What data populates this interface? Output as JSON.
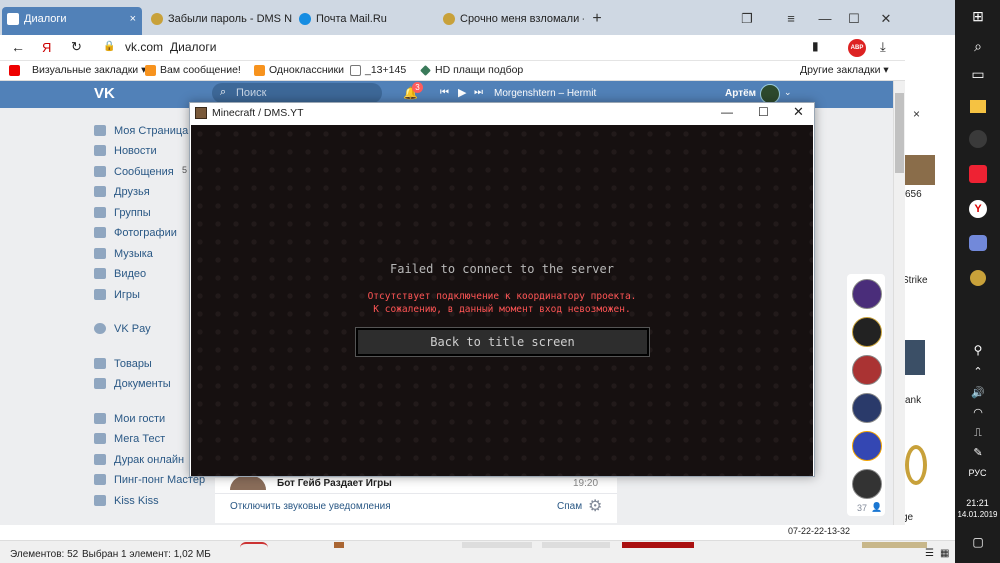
{
  "browser": {
    "tabs": [
      {
        "label": "Диалоги",
        "active": true
      },
      {
        "label": "Забыли пароль - DMS NET"
      },
      {
        "label": "Почта Mail.Ru"
      },
      {
        "label": "Срочно меня взломали - ..."
      }
    ],
    "new_tab": "+",
    "url": "vk.com",
    "page_title": "Диалоги",
    "bookmarks": [
      {
        "label": "Визуальные закладки"
      },
      {
        "label": "Вам сообщение!"
      },
      {
        "label": "Одноклассники"
      },
      {
        "label": "_13+145"
      },
      {
        "label": "HD плащи подбор"
      }
    ],
    "other_bookmarks": "Другие закладки"
  },
  "vk": {
    "search_placeholder": "Поиск",
    "notifications_count": "3",
    "now_playing": "Morgenshtern – Hermit",
    "user_name": "Артём",
    "sidebar": [
      {
        "label": "Моя Страница"
      },
      {
        "label": "Новости"
      },
      {
        "label": "Сообщения",
        "badge": "5"
      },
      {
        "label": "Друзья"
      },
      {
        "label": "Группы"
      },
      {
        "label": "Фотографии"
      },
      {
        "label": "Музыка"
      },
      {
        "label": "Видео"
      },
      {
        "label": "Игры"
      },
      {
        "label": "VK Pay"
      },
      {
        "label": "Товары"
      },
      {
        "label": "Документы"
      },
      {
        "label": "Мои гости"
      },
      {
        "label": "Мега Тест"
      },
      {
        "label": "Дурак онлайн"
      },
      {
        "label": "Пинг-понг Мастер"
      },
      {
        "label": "Kiss Kiss"
      }
    ],
    "dialog_preview": {
      "name": "Бот Гейб Раздает Игры",
      "time": "19:20"
    },
    "mute_label": "Отключить звуковые уведомления",
    "spam_label": "Спам",
    "online_count": "37"
  },
  "right_peek": [
    "656",
    "Strike",
    "ank",
    "ge"
  ],
  "minecraft": {
    "window_title": "Minecraft / DMS.YT",
    "heading": "Failed to connect to the server",
    "error_line1": "Отсутствует подключение к координатору проекта.",
    "error_line2": "К сожалению, в данный момент вход невозможен.",
    "back_button": "Back to title screen",
    "heading_color": "#b8b8b8",
    "error_color": "#ff5555"
  },
  "statusbar": {
    "items_count": "Элементов: 52",
    "selected": "Выбран 1 элемент: 1,02 МБ",
    "date_label": "07-22-22-13-32"
  },
  "taskbar": {
    "language": "РУС",
    "time": "21:21",
    "date": "14.01.2019"
  },
  "colors": {
    "vk_blue": "#5181b8",
    "taskbar": "#1c1c1c"
  }
}
